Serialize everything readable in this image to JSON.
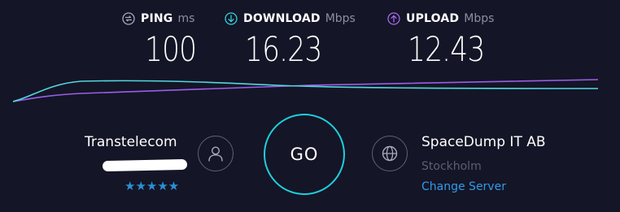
{
  "metrics": {
    "ping": {
      "label": "PING",
      "unit": "ms",
      "value": "100",
      "icon": "ping-icon",
      "icon_color": "#a8abbd"
    },
    "download": {
      "label": "DOWNLOAD",
      "unit": "Mbps",
      "value": "16.23",
      "icon": "download-arrow-icon",
      "icon_color": "#2fd4dc"
    },
    "upload": {
      "label": "UPLOAD",
      "unit": "Mbps",
      "value": "12.43",
      "icon": "upload-arrow-icon",
      "icon_color": "#a56af0"
    }
  },
  "graph": {
    "download_color": "#53d6df",
    "upload_color": "#9a5ee8"
  },
  "isp": {
    "name": "Transtelecom",
    "rating": "★★★★★",
    "rating_stars": 5,
    "rating_color": "#2b8fd6",
    "icon": "user-icon"
  },
  "go": {
    "label": "GO",
    "ring_color": "#1fcedc"
  },
  "server": {
    "name": "SpaceDump IT AB",
    "location": "Stockholm",
    "change_label": "Change Server",
    "icon": "globe-icon",
    "link_color": "#2f9bea"
  },
  "colors": {
    "background": "#141526"
  }
}
